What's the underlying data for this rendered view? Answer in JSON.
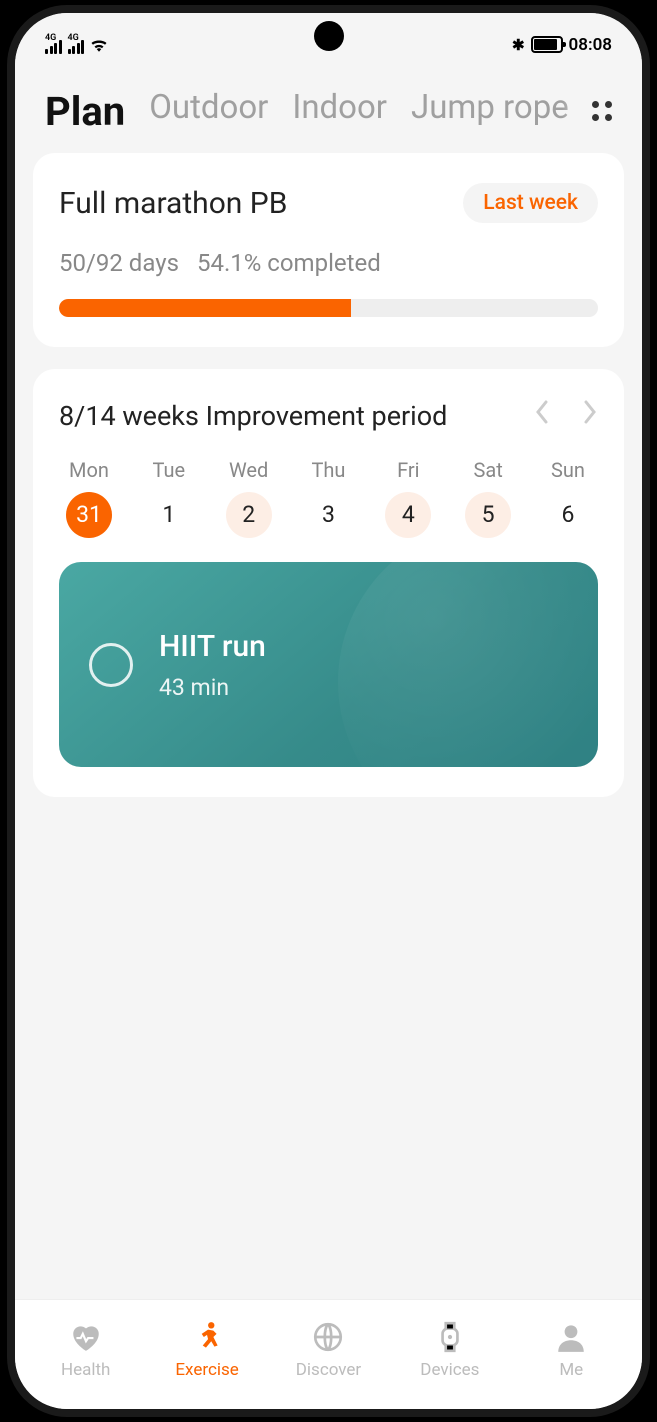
{
  "status": {
    "signal1_label": "4G",
    "signal2_label": "4G",
    "time": "08:08"
  },
  "tabs": {
    "items": [
      "Plan",
      "Outdoor",
      "Indoor",
      "Jump rope"
    ],
    "active_index": 0
  },
  "plan": {
    "title": "Full marathon PB",
    "badge": "Last week",
    "days_text": "50/92 days",
    "completed_text": "54.1% completed",
    "progress_percent": 54.1
  },
  "period": {
    "title": "8/14 weeks Improvement period",
    "days": [
      {
        "label": "Mon",
        "num": "31",
        "state": "active"
      },
      {
        "label": "Tue",
        "num": "1",
        "state": "none"
      },
      {
        "label": "Wed",
        "num": "2",
        "state": "marked"
      },
      {
        "label": "Thu",
        "num": "3",
        "state": "none"
      },
      {
        "label": "Fri",
        "num": "4",
        "state": "marked"
      },
      {
        "label": "Sat",
        "num": "5",
        "state": "marked"
      },
      {
        "label": "Sun",
        "num": "6",
        "state": "none"
      }
    ]
  },
  "workout": {
    "title": "HIIT run",
    "duration": "43 min"
  },
  "bottom_nav": {
    "items": [
      {
        "label": "Health",
        "icon": "heart"
      },
      {
        "label": "Exercise",
        "icon": "runner"
      },
      {
        "label": "Discover",
        "icon": "globe"
      },
      {
        "label": "Devices",
        "icon": "watch"
      },
      {
        "label": "Me",
        "icon": "person"
      }
    ],
    "active_index": 1
  },
  "colors": {
    "accent": "#fa6400",
    "teal": "#3a9a99"
  }
}
